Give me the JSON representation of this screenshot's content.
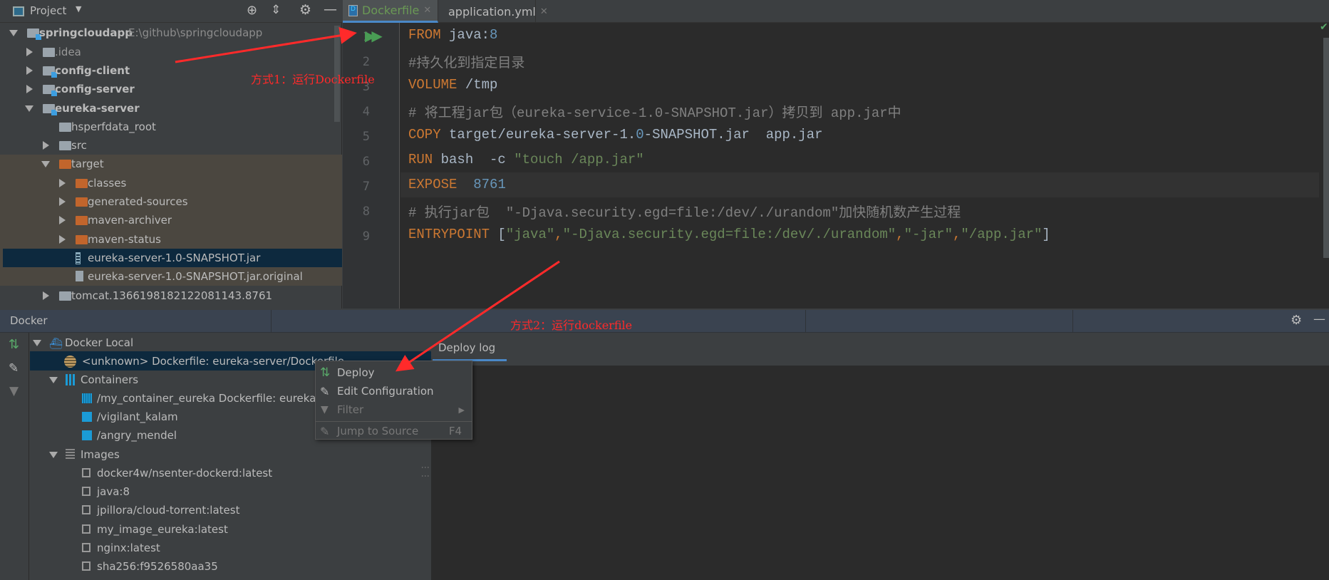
{
  "project_panel": {
    "title": "Project",
    "tree": [
      {
        "label": "springcloudapp",
        "path": "E:\\github\\springcloudapp",
        "bold": true
      },
      {
        "label": ".idea"
      },
      {
        "label": "config-client",
        "bold": true
      },
      {
        "label": "config-server",
        "bold": true
      },
      {
        "label": "eureka-server",
        "bold": true
      },
      {
        "label": "hsperfdata_root"
      },
      {
        "label": "src"
      },
      {
        "label": "target"
      },
      {
        "label": "classes"
      },
      {
        "label": "generated-sources"
      },
      {
        "label": "maven-archiver"
      },
      {
        "label": "maven-status"
      },
      {
        "label": "eureka-server-1.0-SNAPSHOT.jar"
      },
      {
        "label": "eureka-server-1.0-SNAPSHOT.jar.original"
      },
      {
        "label": "tomcat.1366198182122081143.8761"
      }
    ]
  },
  "editor": {
    "tabs": [
      {
        "label": "Dockerfile",
        "active": true
      },
      {
        "label": "application.yml"
      }
    ],
    "lines": [
      [
        {
          "t": "FROM",
          "c": "k"
        },
        {
          "t": " java:",
          "c": "p"
        },
        {
          "t": "8",
          "c": "n"
        }
      ],
      [
        {
          "t": "#持久化到指定目录",
          "c": "c"
        }
      ],
      [
        {
          "t": "VOLUME",
          "c": "k"
        },
        {
          "t": " /tmp",
          "c": "p"
        }
      ],
      [
        {
          "t": "# 将工程jar包（eureka-service-1.0-SNAPSHOT.jar）拷贝到 app.jar中",
          "c": "c"
        }
      ],
      [
        {
          "t": "COPY",
          "c": "k"
        },
        {
          "t": " target/eureka-server-1.",
          "c": "p"
        },
        {
          "t": "0",
          "c": "n"
        },
        {
          "t": "-SNAPSHOT.jar  app.jar",
          "c": "p"
        }
      ],
      [
        {
          "t": "RUN",
          "c": "k"
        },
        {
          "t": " bash  -c ",
          "c": "p"
        },
        {
          "t": "\"touch /app.jar\"",
          "c": "s"
        }
      ],
      [
        {
          "t": "EXPOSE",
          "c": "k"
        },
        {
          "t": "  ",
          "c": "p"
        },
        {
          "t": "8761",
          "c": "n"
        }
      ],
      [
        {
          "t": "# 执行jar包  \"-Djava.security.egd=file:/dev/./urandom\"加快随机数产生过程",
          "c": "c"
        }
      ],
      [
        {
          "t": "ENTRYPOINT",
          "c": "k"
        },
        {
          "t": " [",
          "c": "p"
        },
        {
          "t": "\"java\"",
          "c": "s"
        },
        {
          "t": ",",
          "c": "k"
        },
        {
          "t": "\"-Djava.security.egd=file:/dev/./urandom\"",
          "c": "s"
        },
        {
          "t": ",",
          "c": "k"
        },
        {
          "t": "\"-jar\"",
          "c": "s"
        },
        {
          "t": ",",
          "c": "k"
        },
        {
          "t": "\"/app.jar\"",
          "c": "s"
        },
        {
          "t": "]",
          "c": "p"
        }
      ]
    ]
  },
  "annotations": {
    "method1": "方式1：运行Dockerfile",
    "method2": "方式2：运行dockerfile"
  },
  "docker_panel": {
    "title": "Docker",
    "root": "Docker Local",
    "selected": "<unknown> Dockerfile: eureka-server/Dockerfile",
    "containers_label": "Containers",
    "containers": [
      "/my_container_eureka Dockerfile: eureka-server/Dockerfile",
      "/vigilant_kalam",
      "/angry_mendel"
    ],
    "images_label": "Images",
    "images": [
      "docker4w/nsenter-dockerd:latest",
      "java:8",
      "jpillora/cloud-torrent:latest",
      "my_image_eureka:latest",
      "nginx:latest",
      "sha256:f9526580aa35"
    ],
    "deploy_log_tab": "Deploy log"
  },
  "context_menu": {
    "items": [
      {
        "label": "Deploy",
        "enabled": true
      },
      {
        "label": "Edit Configuration",
        "enabled": true
      },
      {
        "label": "Filter",
        "enabled": false
      },
      {
        "label": "Jump to Source",
        "shortcut": "F4",
        "enabled": false
      }
    ]
  }
}
